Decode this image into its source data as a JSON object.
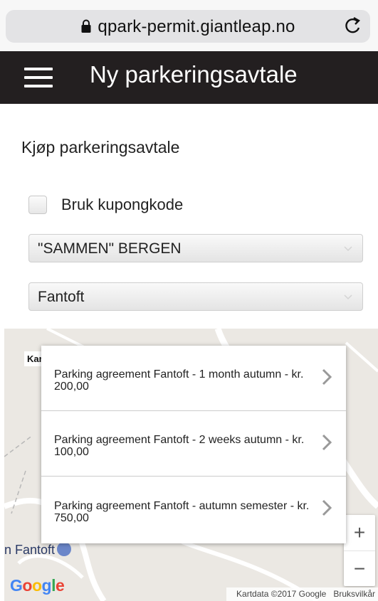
{
  "browser": {
    "url": "qpark-permit.giantleap.no"
  },
  "header": {
    "title": "Ny parkeringsavtale"
  },
  "form": {
    "section_title": "Kjøp parkeringsavtale",
    "coupon_label": "Bruk kupongkode",
    "coupon_checked": false,
    "select_company": "\"SAMMEN\" BERGEN",
    "select_location": "Fantoft"
  },
  "map": {
    "label_kar": "Kar",
    "place_label": "n Fantoft",
    "zoom_in": "+",
    "zoom_out": "−",
    "logo": "Google",
    "attribution": "Kartdata ©2017 Google",
    "terms": "Bruksvilkår"
  },
  "agreements": [
    {
      "text": "Parking agreement Fantoft - 1 month autumn - kr. 200,00"
    },
    {
      "text": "Parking agreement Fantoft - 2 weeks autumn - kr. 100,00"
    },
    {
      "text": "Parking agreement Fantoft - autumn semester - kr. 750,00"
    }
  ],
  "colors": {
    "header_bg": "#231f20",
    "url_bar_bg": "#e3e3e5",
    "map_bg": "#ebe8e3"
  },
  "icons": {
    "lock": "lock-icon",
    "reload": "reload-icon",
    "menu": "hamburger-menu-icon",
    "chevron": "chevron-right-icon",
    "select_arrow": "chevron-down-icon"
  }
}
